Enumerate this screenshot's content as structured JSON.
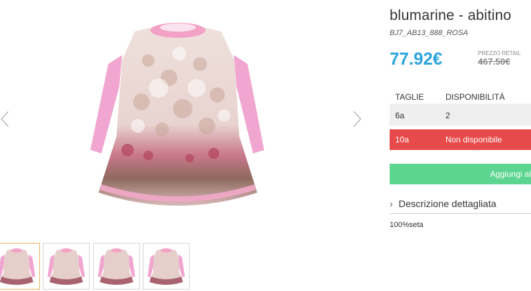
{
  "product": {
    "title": "blumarine - abitino",
    "sku": "BJ7_AB13_888_ROSA",
    "price": "77.92€",
    "retail_label": "PREZZO RETAIL",
    "retail_price": "467.50€"
  },
  "sizes": {
    "header_size": "TAGLIE",
    "header_availability": "DISPONIBILITÀ",
    "rows": [
      {
        "size": "6a",
        "availability": "2",
        "status": "available"
      },
      {
        "size": "10a",
        "availability": "Non disponibile",
        "status": "unavailable"
      }
    ]
  },
  "add_button_label": "Aggiungi al",
  "description": {
    "toggle_label": "Descrizione dettagliata",
    "text": "100%seta"
  },
  "gallery": {
    "thumb_count": 4,
    "active_thumb": 0,
    "prev_icon": "chevron-left-icon",
    "next_icon": "chevron-right-icon"
  },
  "colors": {
    "price": "#2aa4de",
    "unavailable": "#e74a4a",
    "add_button": "#5bd58f",
    "active_thumb_border": "#f0b357"
  }
}
